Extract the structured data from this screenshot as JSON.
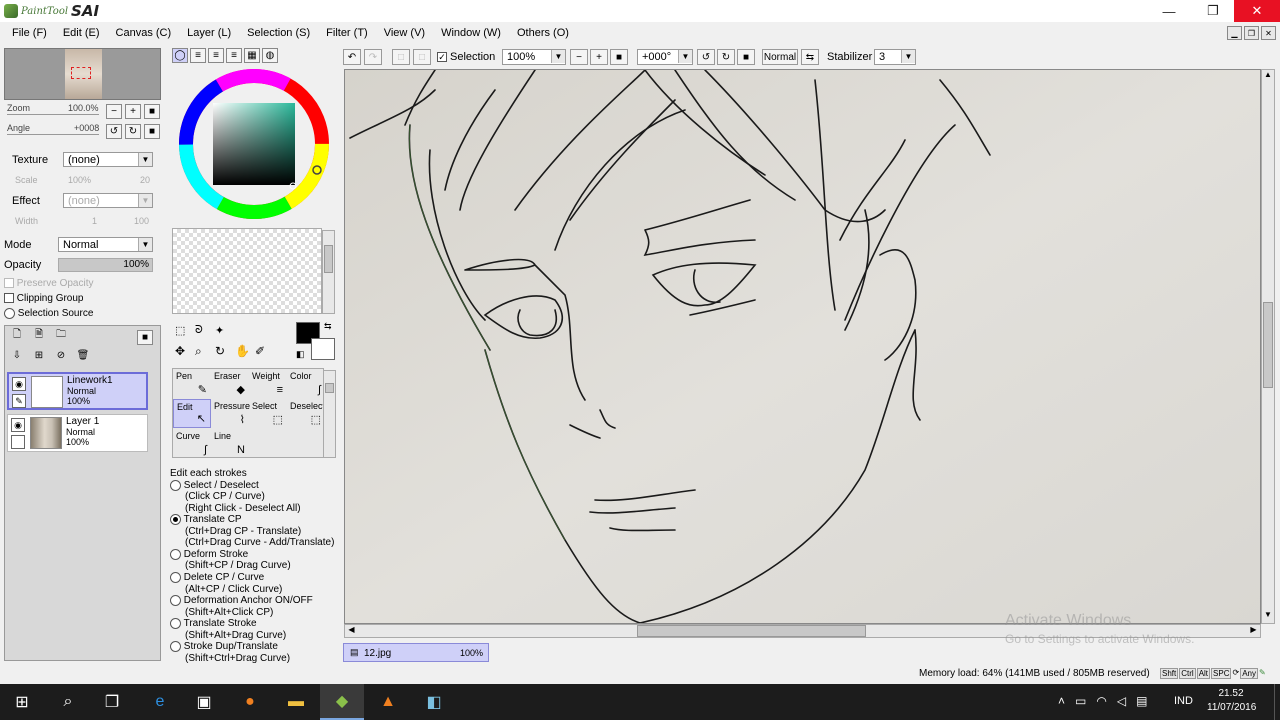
{
  "app": {
    "name_small": "PaintTool",
    "name_big": "SAI"
  },
  "window_controls": {
    "minimize": "—",
    "restore": "❐",
    "close": "✕"
  },
  "menu": [
    "File (F)",
    "Edit (E)",
    "Canvas (C)",
    "Layer (L)",
    "Selection (S)",
    "Filter (T)",
    "View (V)",
    "Window (W)",
    "Others (O)"
  ],
  "navigator": {
    "zoom_label": "Zoom",
    "zoom_value": "100.0%",
    "angle_label": "Angle",
    "angle_value": "+0008"
  },
  "texture": {
    "label": "Texture",
    "value": "(none)",
    "scale_label": "Scale",
    "scale_value": "100%",
    "scale_num": "20"
  },
  "effect": {
    "label": "Effect",
    "value": "(none)",
    "width_label": "Width",
    "width_value": "1",
    "width_num": "100"
  },
  "mode": {
    "label": "Mode",
    "value": "Normal"
  },
  "opacity": {
    "label": "Opacity",
    "value": "100%",
    "fraction": 1.0
  },
  "checks": {
    "preserve": "Preserve Opacity",
    "clipping": "Clipping Group",
    "selsource": "Selection Source"
  },
  "layers": [
    {
      "name": "Linework1",
      "mode": "Normal",
      "opacity": "100%"
    },
    {
      "name": "Layer 1",
      "mode": "Normal",
      "opacity": "100%"
    }
  ],
  "tools": [
    {
      "label": "Pen",
      "icon": "✎"
    },
    {
      "label": "Eraser",
      "icon": "◆"
    },
    {
      "label": "Weight",
      "icon": "≡"
    },
    {
      "label": "Color",
      "icon": "∫"
    },
    {
      "label": "Edit",
      "icon": "↖"
    },
    {
      "label": "Pressure",
      "icon": "⌇"
    },
    {
      "label": "Select",
      "icon": "⬚"
    },
    {
      "label": "Deselect",
      "icon": "⬚"
    },
    {
      "label": "Curve",
      "icon": "∫"
    },
    {
      "label": "Line",
      "icon": "N"
    }
  ],
  "edit_options": {
    "title": "Edit each strokes",
    "items": [
      {
        "label": "Select / Deselect",
        "lines": [
          "(Click CP / Curve)",
          "(Right Click - Deselect All)"
        ],
        "checked": false
      },
      {
        "label": "Translate CP",
        "lines": [
          "(Ctrl+Drag CP - Translate)",
          "(Ctrl+Drag Curve - Add/Translate)"
        ],
        "checked": true
      },
      {
        "label": "Deform Stroke",
        "lines": [
          "(Shift+CP / Drag Curve)"
        ],
        "checked": false
      },
      {
        "label": "Delete CP / Curve",
        "lines": [
          "(Alt+CP / Click Curve)"
        ],
        "checked": false
      },
      {
        "label": "Deformation Anchor ON/OFF",
        "lines": [
          "(Shift+Alt+Click CP)"
        ],
        "checked": false
      },
      {
        "label": "Translate Stroke",
        "lines": [
          "(Shift+Alt+Drag Curve)"
        ],
        "checked": false
      },
      {
        "label": "Stroke Dup/Translate",
        "lines": [
          "(Shift+Ctrl+Drag Curve)"
        ],
        "checked": false
      }
    ]
  },
  "toolbar": {
    "selection_label": "Selection",
    "zoom": "100%",
    "angle": "+000°",
    "blend": "Normal",
    "stabilizer_label": "Stabilizer",
    "stabilizer_value": "3"
  },
  "document": {
    "name": "12.jpg",
    "zoom": "100%"
  },
  "status": {
    "memory": "Memory load: 64% (141MB used / 805MB reserved)",
    "keys": [
      "Shft",
      "Ctrl",
      "Alt",
      "SPC"
    ],
    "any": "Any"
  },
  "watermark": {
    "line1": "Activate Windows",
    "line2": "Go to Settings to activate Windows."
  },
  "taskbar": {
    "lang": "IND",
    "time": "21.52",
    "date": "11/07/2016"
  },
  "colors": {
    "selected": "#cfd0f8",
    "accent": "#6c6cd8",
    "close": "#e81123"
  }
}
